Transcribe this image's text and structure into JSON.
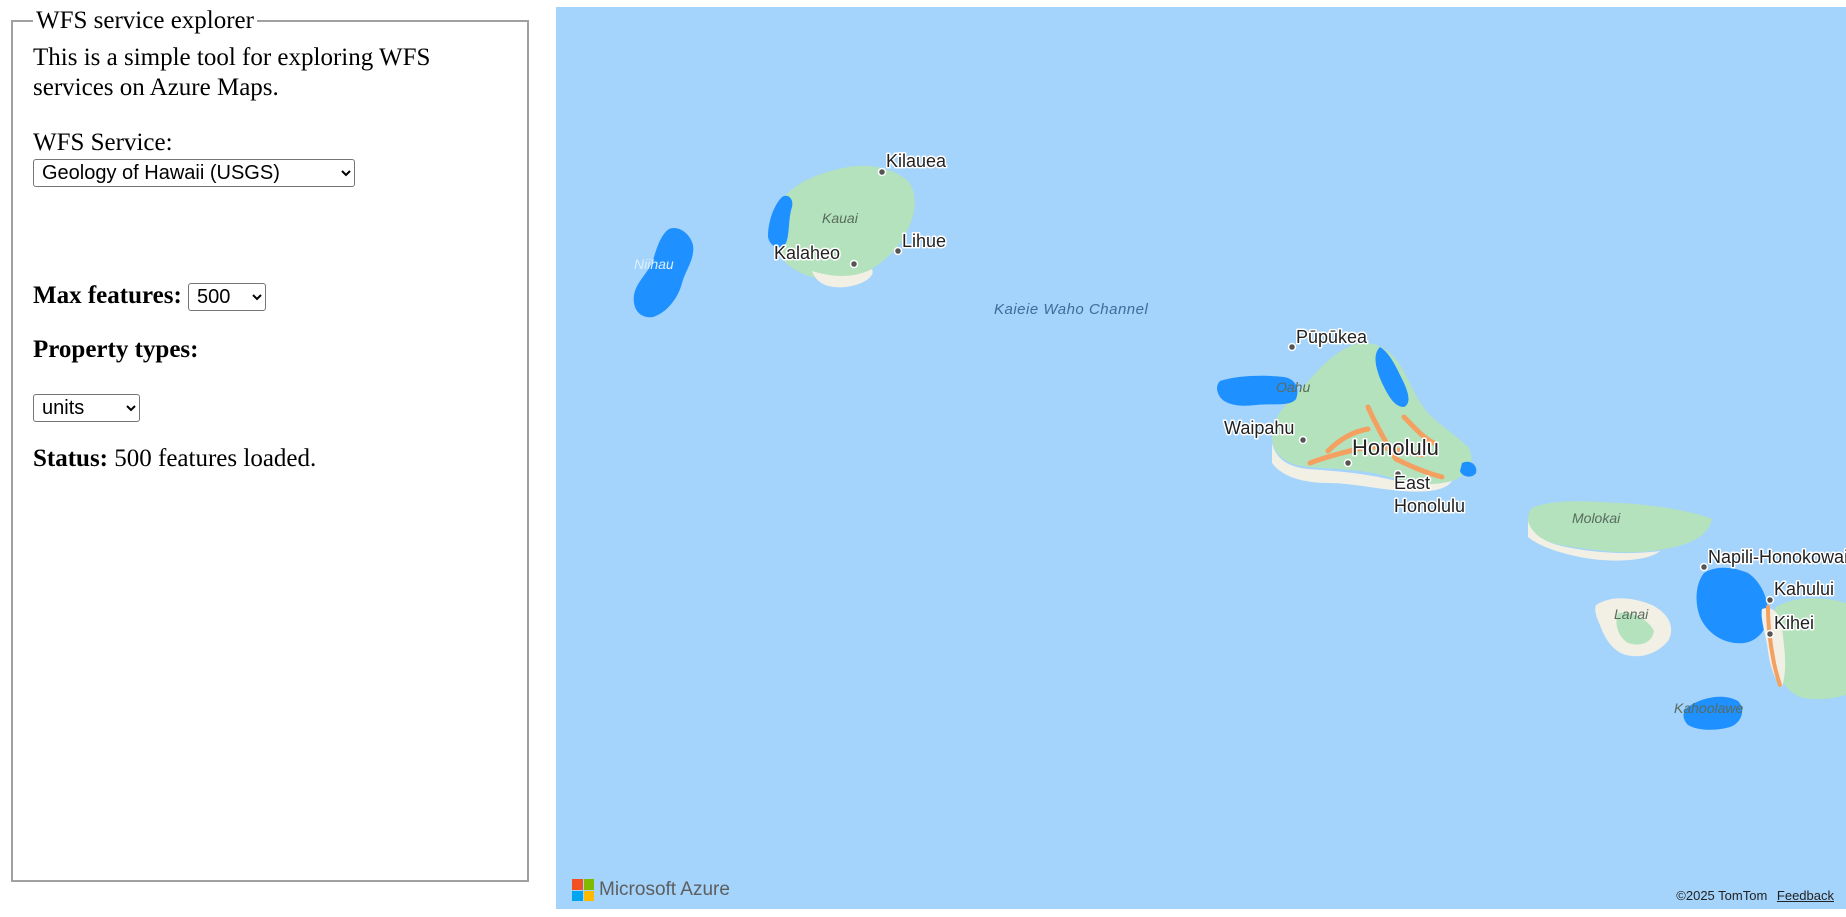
{
  "panel": {
    "legend": "WFS service explorer",
    "intro": "This is a simple tool for exploring WFS services on Azure Maps.",
    "service_label": "WFS Service:",
    "service_selected": "Geology of Hawaii (USGS)",
    "max_features_label": "Max features:",
    "max_features_selected": "500",
    "property_types_label": "Property types:",
    "property_selected": "units",
    "status_label": "Status:",
    "status_text": "500 features loaded."
  },
  "map": {
    "places": {
      "kilauea": "Kilauea",
      "lihue": "Lihue",
      "kalaheo": "Kalaheo",
      "kauai": "Kauai",
      "niihau": "Niihau",
      "channel": "Kaieie Waho Channel",
      "pupukea": "Pūpūkea",
      "oahu": "Oahu",
      "waipahu": "Waipahu",
      "honolulu": "Honolulu",
      "east_honolulu_1": "East",
      "east_honolulu_2": "Honolulu",
      "molokai": "Molokai",
      "napili": "Napili-Honokowai",
      "kahului": "Kahului",
      "kihei": "Kihei",
      "lanai": "Lanai",
      "kahoolawe": "Kahoolawe"
    },
    "branding": "Microsoft Azure",
    "copyright": "©2025 TomTom",
    "feedback": "Feedback",
    "colors": {
      "ocean": "#a4d3fb",
      "land": "#b3e2bd",
      "land_dry": "#f2efe4",
      "feature_fill": "#1e90ff",
      "road": "#f4a061"
    }
  }
}
